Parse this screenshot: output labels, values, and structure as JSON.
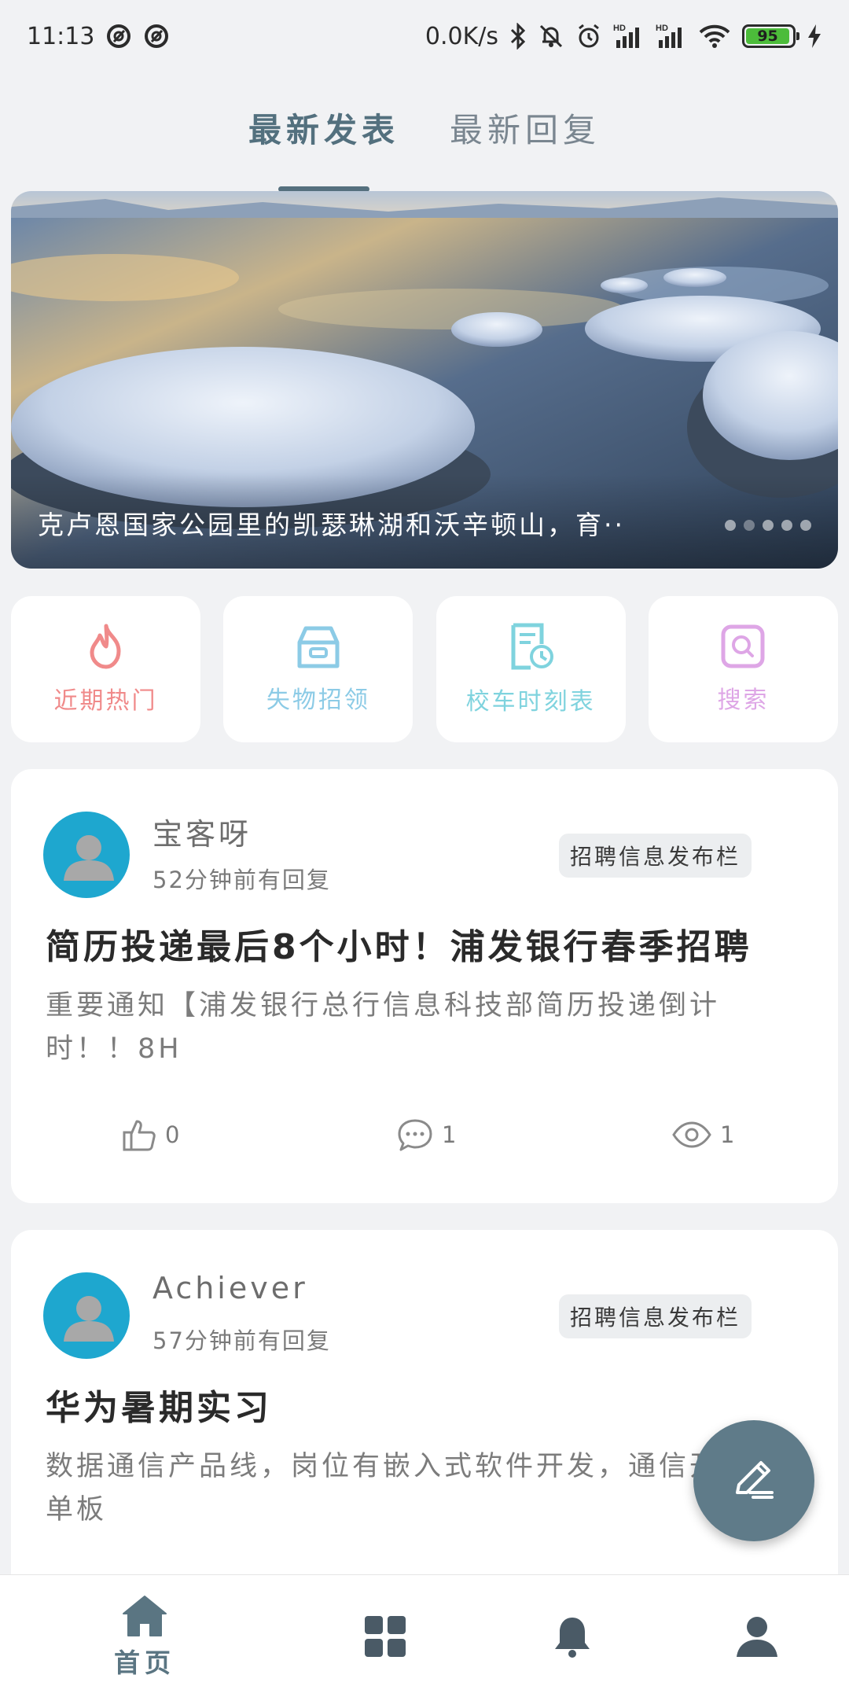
{
  "status_bar": {
    "time": "11:13",
    "net_speed": "0.0K/s",
    "hd1": "HD",
    "hd2": "HD",
    "battery": "95",
    "icons": [
      "at-icon",
      "at-icon",
      "bluetooth-icon",
      "mute-icon",
      "alarm-icon",
      "signal-icon",
      "signal-icon",
      "wifi-icon",
      "battery-icon",
      "charging-icon"
    ]
  },
  "top_tabs": {
    "latest_posts": "最新发表",
    "latest_replies": "最新回复"
  },
  "banner": {
    "caption": "克卢恩国家公园里的凯瑟琳湖和沃辛顿山，育··",
    "dots": 5
  },
  "quick_actions": [
    {
      "label": "近期热门",
      "icon": "flame-icon",
      "color": "#f08a8a"
    },
    {
      "label": "失物招领",
      "icon": "lost-found-box-icon",
      "color": "#8ccbe6"
    },
    {
      "label": "校车时刻表",
      "icon": "bus-schedule-icon",
      "color": "#7fd3de"
    },
    {
      "label": "搜索",
      "icon": "search-icon",
      "color": "#dea6e6"
    }
  ],
  "posts": [
    {
      "author": "宝客呀",
      "reply_time": "52分钟前有回复",
      "category": "招聘信息发布栏",
      "title": "简历投递最后8个小时！浦发银行春季招聘",
      "excerpt": "重要通知【浦发银行总行信息科技部简历投递倒计时！！8H",
      "likes": "0",
      "comments": "1",
      "views": "1"
    },
    {
      "author": "Achiever",
      "reply_time": "57分钟前有回复",
      "category": "招聘信息发布栏",
      "title": "华为暑期实习",
      "excerpt": "数据通信产品线，岗位有嵌入式软件开发，通信开发，单板"
    }
  ],
  "bottom_nav": {
    "home_label": "首页",
    "items": [
      "home-icon",
      "grid-icon",
      "bell-icon",
      "user-icon"
    ]
  },
  "colors": {
    "accent": "#55707e",
    "background": "#f1f2f4",
    "fab": "#5f7b89",
    "avatar": "#1ea7cf"
  }
}
